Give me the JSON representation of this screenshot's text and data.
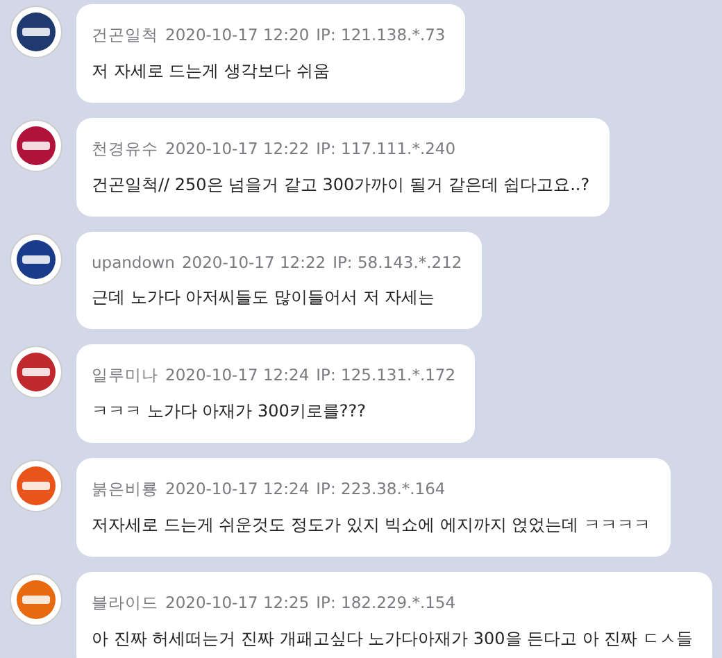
{
  "comments": [
    {
      "author": "건곤일척",
      "time": "2020-10-17 12:20",
      "ip": "IP: 121.138.*.73",
      "text": "저 자세로 드는게 생각보다 쉬움",
      "color": "#1f3a6e"
    },
    {
      "author": "천경유수",
      "time": "2020-10-17 12:22",
      "ip": "IP: 117.111.*.240",
      "text": "건곤일척// 250은 넘을거 같고 300가까이 될거 같은데 쉽다고요..?",
      "color": "#b0123a"
    },
    {
      "author": "upandown",
      "time": "2020-10-17 12:22",
      "ip": "IP: 58.143.*.212",
      "text": "근데 노가다 아저씨들도 많이들어서 저 자세는",
      "color": "#1a3a8a"
    },
    {
      "author": "일루미나",
      "time": "2020-10-17 12:24",
      "ip": "IP: 125.131.*.172",
      "text": "ㅋㅋㅋ 노가다 아재가 300키로를???",
      "color": "#c0282e"
    },
    {
      "author": "붉은비룡",
      "time": "2020-10-17 12:24",
      "ip": "IP: 223.38.*.164",
      "text": "저자세로 드는게 쉬운것도 정도가 있지 빅쇼에 에지까지 얹었는데 ㅋㅋㅋㅋ",
      "color": "#e8541a"
    },
    {
      "author": "블라이드",
      "time": "2020-10-17 12:25",
      "ip": "IP: 182.229.*.154",
      "text": "아 진짜 허세떠는거 진짜 개패고싶다 노가다아재가 300을 든다고 아 진짜 ㄷㅅ들",
      "color": "#e86a10"
    }
  ]
}
